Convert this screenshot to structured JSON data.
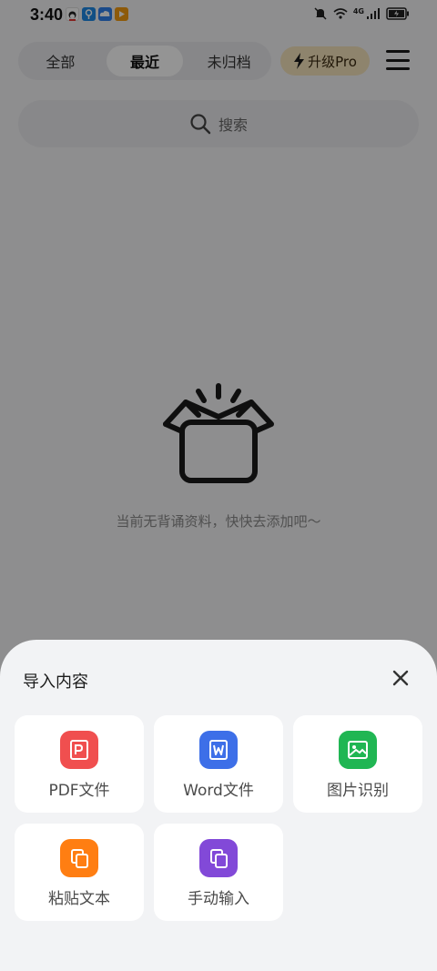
{
  "status_bar": {
    "time": "3:40",
    "apps": [
      {
        "icon": "qq-app-icon",
        "color": "#ffffff"
      },
      {
        "icon": "maps-app-icon",
        "color": "#1e88e5"
      },
      {
        "icon": "cloud-app-icon",
        "color": "#2f80ed"
      },
      {
        "icon": "video-app-icon",
        "color": "#f39c12"
      }
    ],
    "network": "4G"
  },
  "tabs": [
    {
      "label": "全部",
      "active": false
    },
    {
      "label": "最近",
      "active": true
    },
    {
      "label": "未归档",
      "active": false
    }
  ],
  "upgrade": {
    "label": "升级Pro",
    "icon": "bolt-icon",
    "color": "#f5e3bc"
  },
  "search": {
    "placeholder": "搜索"
  },
  "empty_state": {
    "icon": "open-box-icon",
    "message": "当前无背诵资料，快快去添加吧～"
  },
  "sheet": {
    "title": "导入内容",
    "close_icon": "close-icon",
    "options": [
      {
        "label": "PDF文件",
        "icon": "pdf-icon",
        "color": "#f04f4f"
      },
      {
        "label": "Word文件",
        "icon": "word-icon",
        "color": "#3d6fe8"
      },
      {
        "label": "图片识别",
        "icon": "image-icon",
        "color": "#20b653"
      },
      {
        "label": "粘贴文本",
        "icon": "paste-icon",
        "color": "#ff7e12"
      },
      {
        "label": "手动输入",
        "icon": "manual-input-icon",
        "color": "#8249d8"
      }
    ]
  }
}
